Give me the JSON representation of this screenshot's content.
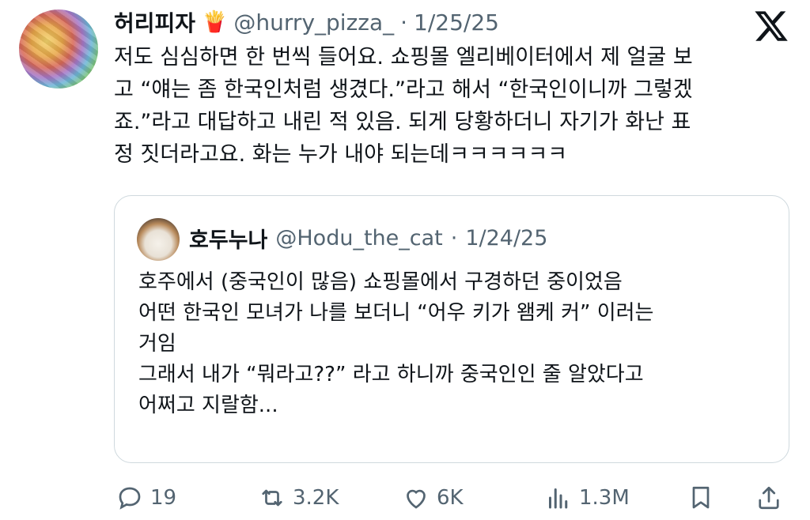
{
  "tweet": {
    "author_name": "허리피자",
    "author_emoji": "🍟",
    "handle": "@hurry_pizza_",
    "separator": "·",
    "date": "1/25/25",
    "lines": [
      "저도 심심하면 한 번씩 들어요. 쇼핑몰 엘리베이터에서 제 얼굴 보",
      "고 “얘는 좀 한국인처럼 생겼다.”라고 해서 “한국인이니까 그렇겠",
      "죠.”라고 대답하고 내린 적 있음. 되게 당황하더니 자기가 화난 표",
      "정 짓더라고요. 화는 누가 내야 되는데ㅋㅋㅋㅋㅋㅋ"
    ]
  },
  "quote": {
    "author_name": "호두누나",
    "handle": "@Hodu_the_cat",
    "separator": "·",
    "date": "1/24/25",
    "lines": [
      "호주에서 (중국인이 많음) 쇼핑몰에서 구경하던 중이었음",
      "어떤 한국인 모녀가 나를 보더니 “어우 키가 왬케 커” 이러는",
      "거임",
      "그래서 내가 “뭐라고??” 라고 하니까 중국인인 줄 알았다고",
      "어쩌고 지랄함..."
    ]
  },
  "actions": {
    "replies": "19",
    "reposts": "3.2K",
    "likes": "6K",
    "views": "1.3M"
  },
  "icons": [
    "x-logo-icon",
    "reply-icon",
    "repost-icon",
    "like-icon",
    "views-icon",
    "bookmark-icon",
    "share-icon"
  ],
  "colors": {
    "text": "#0f1419",
    "muted": "#536471",
    "border": "#cfd9de"
  }
}
